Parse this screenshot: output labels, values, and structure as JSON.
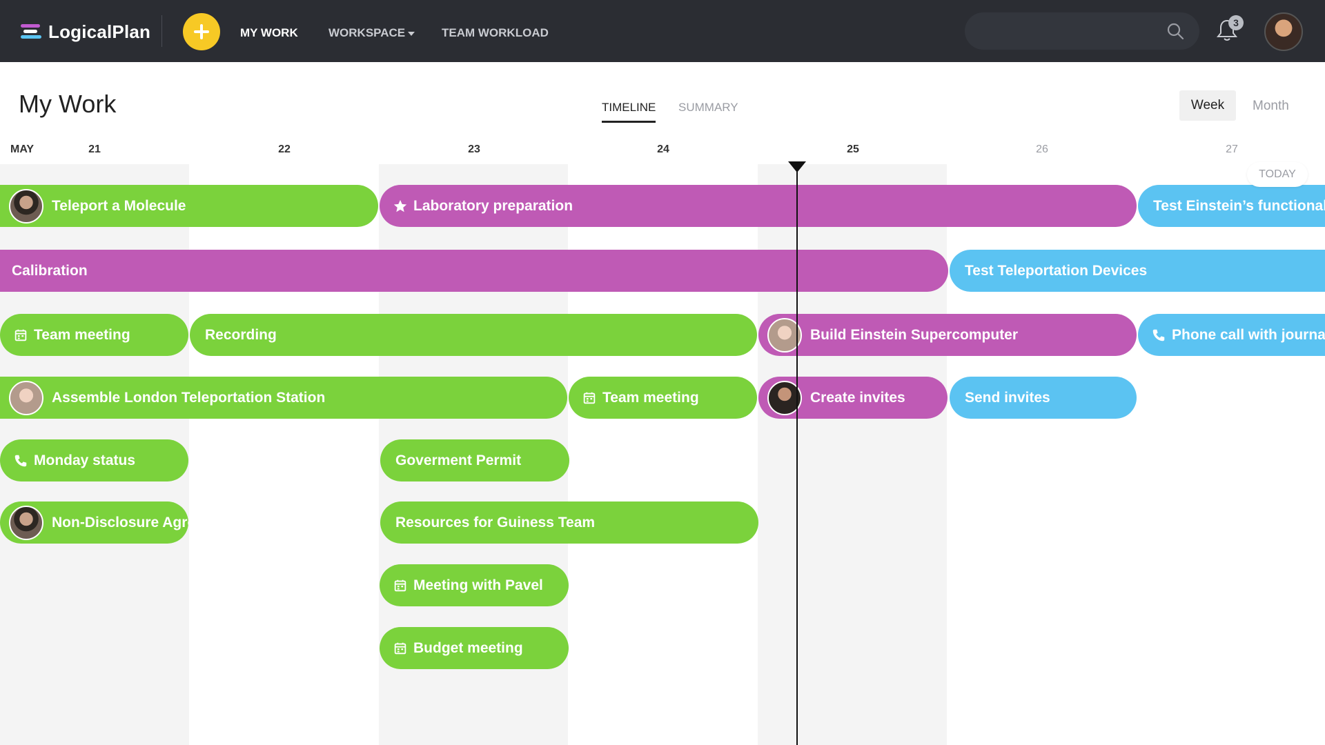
{
  "app": {
    "name": "LogicalPlan",
    "colors": {
      "topbar": "#2b2d33",
      "add": "#f7c925",
      "green": "#7bd23c",
      "purple": "#bf5ab5",
      "blue": "#5bc3f2"
    }
  },
  "nav": {
    "my_work": "MY WORK",
    "workspace": "WORKSPACE",
    "team_workload": "TEAM WORKLOAD",
    "notifications_count": "3"
  },
  "header": {
    "title": "My Work",
    "tabs": {
      "timeline": "TIMELINE",
      "summary": "SUMMARY"
    },
    "views": {
      "week": "Week",
      "month": "Month"
    }
  },
  "timeline": {
    "month": "MAY",
    "days": [
      "21",
      "22",
      "23",
      "24",
      "25",
      "26",
      "27"
    ],
    "today_label": "TODAY"
  },
  "events": [
    {
      "label": "Teleport a Molecule",
      "color": "green",
      "avatar": "person-avatar"
    },
    {
      "label": "Laboratory preparation",
      "color": "purple",
      "icon": "star-icon"
    },
    {
      "label": "Test Einstein’s functionality",
      "color": "blue"
    },
    {
      "label": "Calibration",
      "color": "purple"
    },
    {
      "label": "Test Teleportation Devices",
      "color": "blue"
    },
    {
      "label": "Team meeting",
      "color": "green",
      "icon": "calendar-icon"
    },
    {
      "label": "Recording",
      "color": "green"
    },
    {
      "label": "Build Einstein Supercomputer",
      "color": "purple",
      "avatar": "person-avatar"
    },
    {
      "label": "Phone call with journalist",
      "color": "blue",
      "icon": "phone-icon"
    },
    {
      "label": "Assemble London Teleportation Station",
      "color": "green",
      "avatar": "person-avatar"
    },
    {
      "label": "Team meeting",
      "color": "green",
      "icon": "calendar-icon"
    },
    {
      "label": "Create invites",
      "color": "purple",
      "avatar": "person-avatar"
    },
    {
      "label": "Send invites",
      "color": "blue"
    },
    {
      "label": "Monday status",
      "color": "green",
      "icon": "phone-icon"
    },
    {
      "label": "Goverment Permit",
      "color": "green"
    },
    {
      "label": "Non-Disclosure Agreement",
      "color": "green",
      "avatar": "person-avatar"
    },
    {
      "label": "Resources for Guiness Team",
      "color": "green"
    },
    {
      "label": "Meeting with Pavel",
      "color": "green",
      "icon": "calendar-icon"
    },
    {
      "label": "Budget meeting",
      "color": "green",
      "icon": "calendar-icon"
    }
  ]
}
